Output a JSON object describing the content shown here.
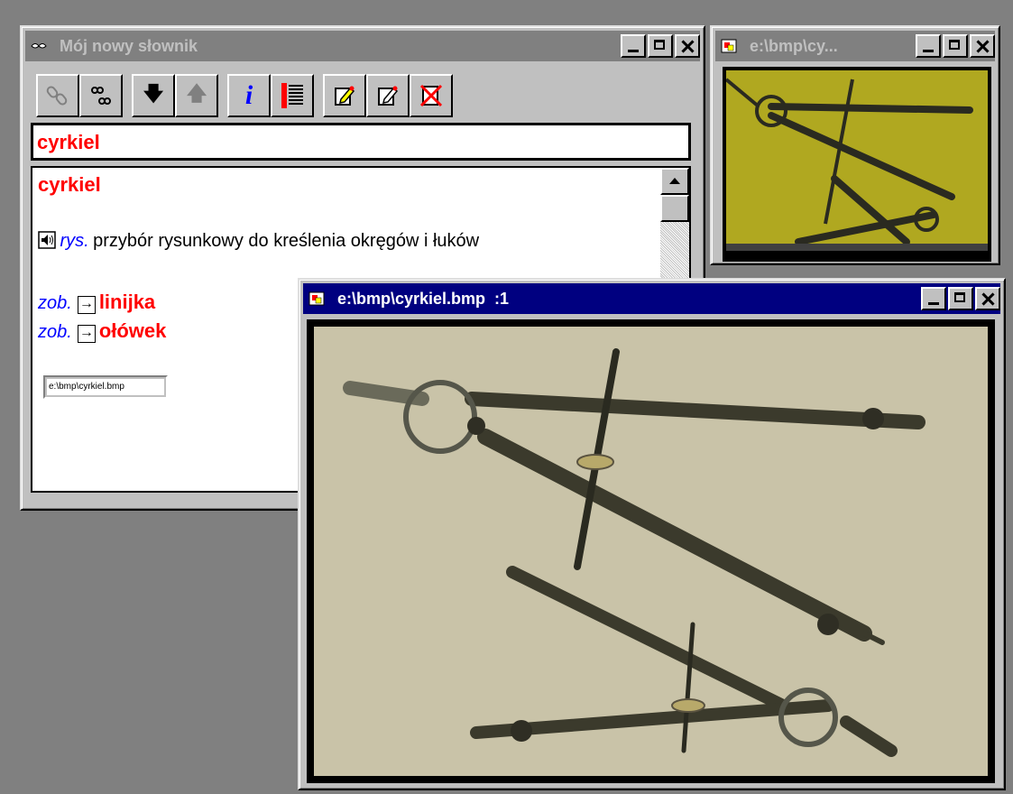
{
  "dictionary": {
    "title": "Mój nowy słownik",
    "search_value": "cyrkiel",
    "entry": {
      "headword": "cyrkiel",
      "pos": "rys.",
      "definition": "przybór rysunkowy do kreślenia okręgów i łuków",
      "refs": [
        {
          "prefix": "zob.",
          "arrow": "→",
          "target": "linijka"
        },
        {
          "prefix": "zob.",
          "arrow": "→",
          "target": "ołówek"
        }
      ],
      "attachment": "e:\\bmp\\cyrkiel.bmp"
    },
    "toolbar": {
      "buttons": [
        {
          "icon": "link-icon"
        },
        {
          "icon": "chain-icon"
        },
        {
          "icon": "arrow-down-icon",
          "label": "🡇"
        },
        {
          "icon": "arrow-up-icon",
          "label": "🡅"
        },
        {
          "icon": "info-icon",
          "label": "i"
        },
        {
          "icon": "list-icon"
        },
        {
          "icon": "edit-icon"
        },
        {
          "icon": "edit-new-icon"
        },
        {
          "icon": "delete-icon"
        }
      ]
    }
  },
  "small_image_window": {
    "title": "e:\\bmp\\cy..."
  },
  "large_image_window": {
    "title": "e:\\bmp\\cyrkiel.bmp  :1"
  },
  "colors": {
    "headword": "#ff0000",
    "pos": "#0000ff",
    "active_titlebar": "#000080",
    "inactive_titlebar": "#808080",
    "desktop": "#808080"
  }
}
